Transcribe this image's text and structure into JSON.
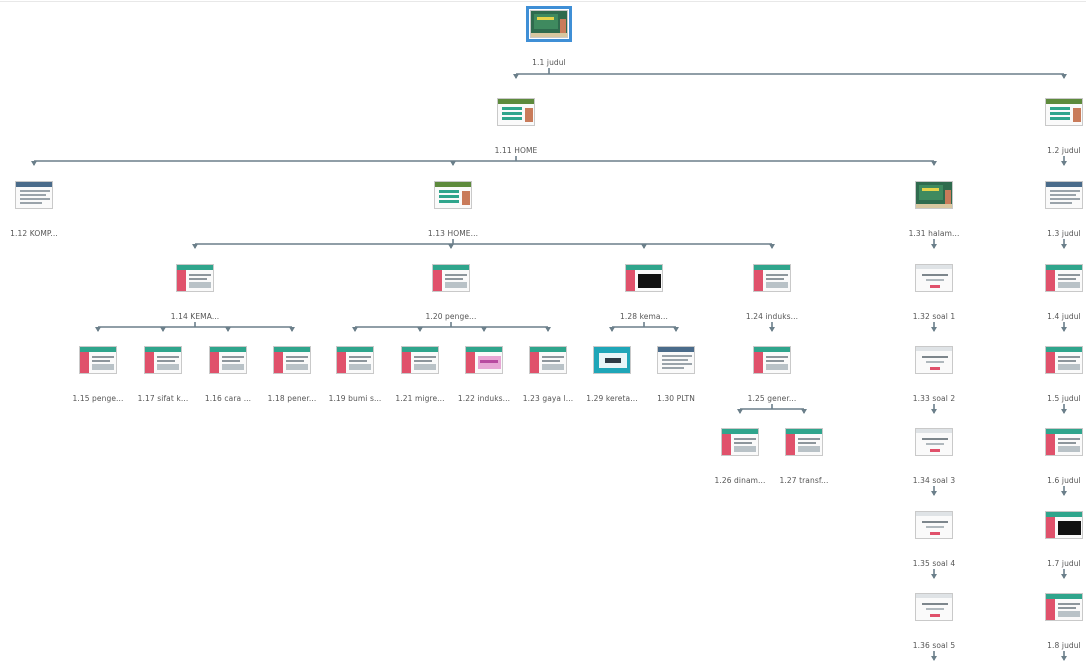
{
  "selected": "1.1",
  "colors": {
    "connector": "#6b7f8a",
    "selection": "#3f8fd6"
  },
  "slides": [
    {
      "id": "1.1",
      "label": "1.1 judul",
      "style": "classroom"
    },
    {
      "id": "1.11",
      "label": "1.11 HOME",
      "style": "menu"
    },
    {
      "id": "1.2",
      "label": "1.2 judul",
      "style": "menu"
    },
    {
      "id": "1.12",
      "label": "1.12 KOMP...",
      "style": "plain"
    },
    {
      "id": "1.13",
      "label": "1.13 HOME...",
      "style": "menu"
    },
    {
      "id": "1.31",
      "label": "1.31 halam...",
      "style": "classroom"
    },
    {
      "id": "1.3",
      "label": "1.3 judul",
      "style": "plain"
    },
    {
      "id": "1.14",
      "label": "1.14 KEMA...",
      "style": "content"
    },
    {
      "id": "1.20",
      "label": "1.20 penge...",
      "style": "content"
    },
    {
      "id": "1.28",
      "label": "1.28 kema...",
      "style": "video"
    },
    {
      "id": "1.24",
      "label": "1.24 induks...",
      "style": "content"
    },
    {
      "id": "1.32",
      "label": "1.32 soal 1",
      "style": "quiz"
    },
    {
      "id": "1.4",
      "label": "1.4 judul",
      "style": "content"
    },
    {
      "id": "1.15",
      "label": "1.15 penge...",
      "style": "content"
    },
    {
      "id": "1.17",
      "label": "1.17 sifat k...",
      "style": "content"
    },
    {
      "id": "1.16",
      "label": "1.16 cara ...",
      "style": "content"
    },
    {
      "id": "1.18",
      "label": "1.18 pener...",
      "style": "content"
    },
    {
      "id": "1.19",
      "label": "1.19 bumi s...",
      "style": "content"
    },
    {
      "id": "1.21",
      "label": "1.21 migre...",
      "style": "content"
    },
    {
      "id": "1.22",
      "label": "1.22 induks...",
      "style": "pink"
    },
    {
      "id": "1.23",
      "label": "1.23 gaya l...",
      "style": "content"
    },
    {
      "id": "1.29",
      "label": "1.29 kereta...",
      "style": "teal"
    },
    {
      "id": "1.30",
      "label": "1.30 PLTN",
      "style": "plain"
    },
    {
      "id": "1.25",
      "label": "1.25 gener...",
      "style": "content"
    },
    {
      "id": "1.33",
      "label": "1.33 soal 2",
      "style": "quiz"
    },
    {
      "id": "1.5",
      "label": "1.5 judul",
      "style": "content"
    },
    {
      "id": "1.26",
      "label": "1.26 dinam...",
      "style": "content"
    },
    {
      "id": "1.27",
      "label": "1.27 transf...",
      "style": "content"
    },
    {
      "id": "1.34",
      "label": "1.34 soal 3",
      "style": "quiz"
    },
    {
      "id": "1.6",
      "label": "1.6 judul",
      "style": "content"
    },
    {
      "id": "1.35",
      "label": "1.35 soal 4",
      "style": "quiz"
    },
    {
      "id": "1.7",
      "label": "1.7 judul",
      "style": "video"
    },
    {
      "id": "1.36",
      "label": "1.36 soal 5",
      "style": "quiz"
    },
    {
      "id": "1.8",
      "label": "1.8 judul",
      "style": "content"
    }
  ],
  "tree": [
    {
      "from": "1.1",
      "to": [
        "1.11",
        "1.2"
      ]
    },
    {
      "from": "1.11",
      "to": [
        "1.12",
        "1.13",
        "1.31"
      ]
    },
    {
      "from": "1.13",
      "to": [
        "1.14",
        "1.20",
        "1.28",
        "1.24"
      ]
    },
    {
      "from": "1.14",
      "to": [
        "1.15",
        "1.17",
        "1.16",
        "1.18"
      ]
    },
    {
      "from": "1.20",
      "to": [
        "1.19",
        "1.21",
        "1.22",
        "1.23"
      ]
    },
    {
      "from": "1.28",
      "to": [
        "1.29",
        "1.30"
      ]
    },
    {
      "from": "1.24",
      "to": [
        "1.25"
      ]
    },
    {
      "from": "1.25",
      "to": [
        "1.26",
        "1.27"
      ]
    },
    {
      "from": "1.31",
      "to": [
        "1.32"
      ]
    },
    {
      "from": "1.32",
      "to": [
        "1.33"
      ]
    },
    {
      "from": "1.33",
      "to": [
        "1.34"
      ]
    },
    {
      "from": "1.34",
      "to": [
        "1.35"
      ]
    },
    {
      "from": "1.35",
      "to": [
        "1.36"
      ]
    },
    {
      "from": "1.36",
      "to": [
        "more"
      ]
    },
    {
      "from": "1.2",
      "to": [
        "1.3"
      ]
    },
    {
      "from": "1.3",
      "to": [
        "1.4"
      ]
    },
    {
      "from": "1.4",
      "to": [
        "1.5"
      ]
    },
    {
      "from": "1.5",
      "to": [
        "1.6"
      ]
    },
    {
      "from": "1.6",
      "to": [
        "1.7"
      ]
    },
    {
      "from": "1.7",
      "to": [
        "1.8"
      ]
    },
    {
      "from": "1.8",
      "to": [
        "more"
      ]
    }
  ]
}
